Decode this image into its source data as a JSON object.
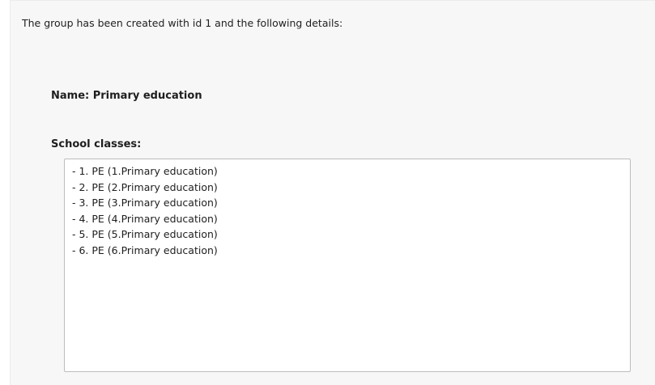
{
  "intro_text": "The group has been created with id 1 and the following details:",
  "name_line": "Name: Primary education",
  "school_classes_label": "School classes:",
  "school_classes": [
    "- 1. PE (1.Primary education)",
    "- 2. PE (2.Primary education)",
    "- 3. PE (3.Primary education)",
    "- 4. PE (4.Primary education)",
    "- 5. PE (5.Primary education)",
    "- 6. PE (6.Primary education)"
  ]
}
